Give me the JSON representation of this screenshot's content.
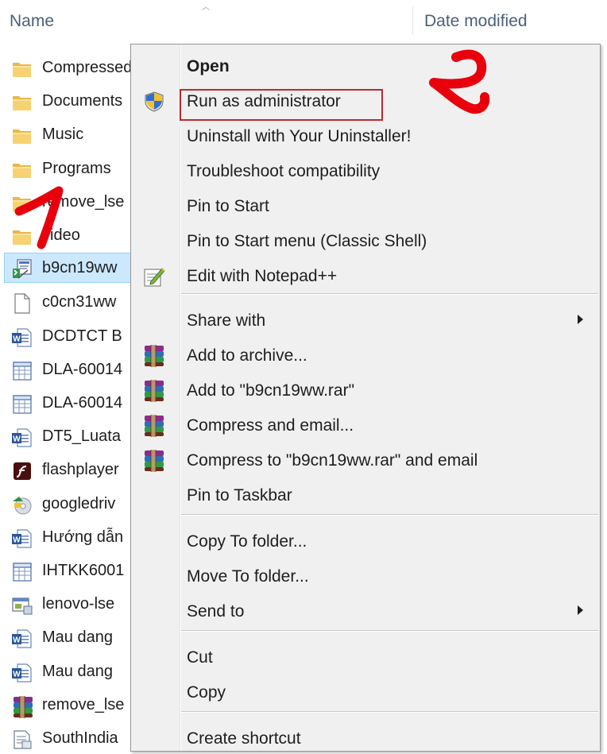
{
  "header": {
    "name_label": "Name",
    "date_label": "Date modified"
  },
  "files": [
    {
      "name": "Compressed",
      "icon": "folder-icon"
    },
    {
      "name": "Documents",
      "icon": "folder-icon"
    },
    {
      "name": "Music",
      "icon": "folder-icon"
    },
    {
      "name": "Programs",
      "icon": "folder-icon"
    },
    {
      "name": "remove_lse",
      "icon": "folder-icon"
    },
    {
      "name": "video",
      "icon": "folder-icon"
    },
    {
      "name": "b9cn19ww",
      "icon": "installer-icon",
      "selected": true
    },
    {
      "name": "c0cn31ww",
      "icon": "blank-file-icon"
    },
    {
      "name": "DCDTCT B",
      "icon": "word-doc-icon"
    },
    {
      "name": "DLA-60014",
      "icon": "spreadsheet-icon"
    },
    {
      "name": "DLA-60014",
      "icon": "spreadsheet-icon"
    },
    {
      "name": "DT5_Luata",
      "icon": "word-doc-icon"
    },
    {
      "name": "flashplayer",
      "icon": "flash-icon"
    },
    {
      "name": "googledriv",
      "icon": "setup-disc-icon"
    },
    {
      "name": "Hướng dẫn",
      "icon": "word-doc-icon"
    },
    {
      "name": "IHTKK6001",
      "icon": "spreadsheet-icon"
    },
    {
      "name": "lenovo-lse",
      "icon": "app-window-icon"
    },
    {
      "name": "Mau dang",
      "icon": "word-doc-icon"
    },
    {
      "name": "Mau dang",
      "icon": "word-doc-icon"
    },
    {
      "name": "remove_lse",
      "icon": "winrar-icon"
    },
    {
      "name": "SouthIndia",
      "icon": "text-doc-icon"
    }
  ],
  "context_menu": {
    "items": [
      {
        "label": "Open",
        "icon": "",
        "bold": true
      },
      {
        "label": "Run as administrator",
        "icon": "uac-shield-icon",
        "highlighted": true
      },
      {
        "label": "Uninstall with Your Uninstaller!",
        "icon": ""
      },
      {
        "label": "Troubleshoot compatibility",
        "icon": ""
      },
      {
        "label": "Pin to Start",
        "icon": ""
      },
      {
        "label": "Pin to Start menu (Classic Shell)",
        "icon": ""
      },
      {
        "label": "Edit with Notepad++",
        "icon": "notepad-plus-icon"
      },
      {
        "label": "Share with",
        "icon": "",
        "submenu": true
      },
      {
        "label": "Add to archive...",
        "icon": "winrar-icon"
      },
      {
        "label": "Add to \"b9cn19ww.rar\"",
        "icon": "winrar-icon"
      },
      {
        "label": "Compress and email...",
        "icon": "winrar-icon"
      },
      {
        "label": "Compress to \"b9cn19ww.rar\" and email",
        "icon": "winrar-icon"
      },
      {
        "label": "Pin to Taskbar",
        "icon": ""
      },
      {
        "label": "Copy To folder...",
        "icon": ""
      },
      {
        "label": "Move To folder...",
        "icon": ""
      },
      {
        "label": "Send to",
        "icon": "",
        "submenu": true
      },
      {
        "label": "Cut",
        "icon": ""
      },
      {
        "label": "Copy",
        "icon": ""
      },
      {
        "label": "Create shortcut",
        "icon": ""
      }
    ]
  },
  "annotations": [
    {
      "mark": "1",
      "color": "#e8000d"
    },
    {
      "mark": "2",
      "color": "#e8000d"
    }
  ],
  "colors": {
    "highlight_box": "#c0282d",
    "selection_bg": "#cce8ff",
    "menu_bg": "#f0f0f0",
    "header_text": "#4c607a"
  }
}
